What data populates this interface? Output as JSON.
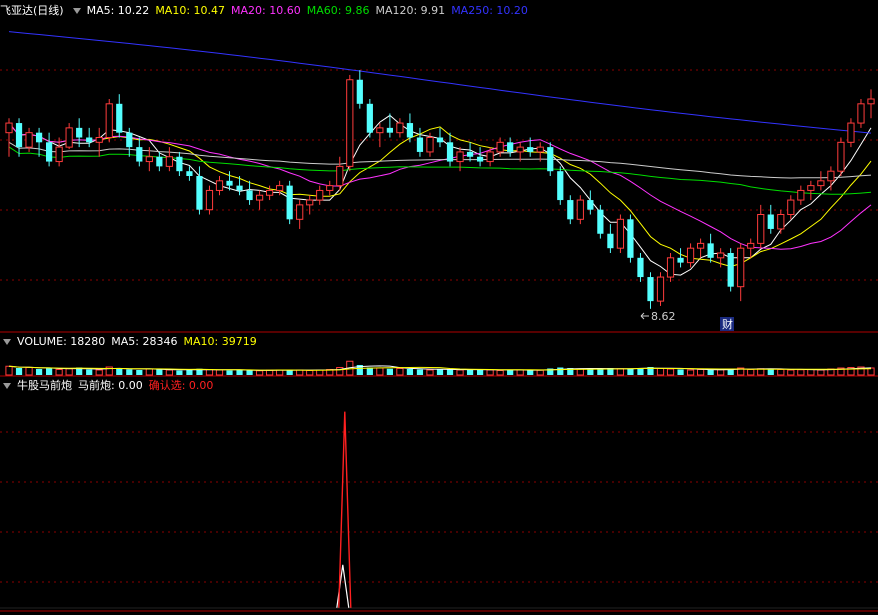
{
  "header": {
    "stock_name": "飞亚达(日线)",
    "ma5_label": "MA5: 10.22",
    "ma10_label": "MA10: 10.47",
    "ma20_label": "MA20: 10.60",
    "ma60_label": "MA60: 9.86",
    "ma120_label": "MA120: 9.91",
    "ma250_label": "MA250: 10.20"
  },
  "volume_header": {
    "volume_label": "VOLUME: 18280",
    "ma5_label": "MA5: 28346",
    "ma10_label": "MA10: 39719"
  },
  "indicator_header": {
    "name": "牛股马前炮",
    "line1_label": "马前炮: 0.00",
    "line2_label": "确认选: 0.00"
  },
  "annotations": {
    "low_price": "8.62",
    "finance_marker": "财"
  },
  "colors": {
    "up": "#ff3c3c",
    "down": "#54ffff",
    "ma5": "#ffffff",
    "ma10": "#ffff00",
    "ma20": "#ff33ff",
    "ma60": "#00dd00",
    "ma120": "#cccccc",
    "ma250": "#3333ff",
    "grid": "#8b0000",
    "indicator_line1": "#ffffff",
    "indicator_line2": "#ff2020"
  },
  "chart_data": {
    "type": "candlestick",
    "ylim": [
      8.4,
      11.6
    ],
    "candles": [
      [
        10.45,
        10.6,
        10.2,
        10.55
      ],
      [
        10.55,
        10.6,
        10.2,
        10.3
      ],
      [
        10.3,
        10.5,
        10.25,
        10.45
      ],
      [
        10.45,
        10.5,
        10.2,
        10.35
      ],
      [
        10.35,
        10.45,
        10.1,
        10.15
      ],
      [
        10.15,
        10.4,
        10.1,
        10.3
      ],
      [
        10.3,
        10.55,
        10.28,
        10.5
      ],
      [
        10.5,
        10.6,
        10.3,
        10.4
      ],
      [
        10.4,
        10.5,
        10.3,
        10.35
      ],
      [
        10.35,
        10.5,
        10.2,
        10.4
      ],
      [
        10.4,
        10.8,
        10.35,
        10.75
      ],
      [
        10.75,
        10.85,
        10.4,
        10.45
      ],
      [
        10.45,
        10.5,
        10.2,
        10.3
      ],
      [
        10.3,
        10.4,
        10.1,
        10.15
      ],
      [
        10.15,
        10.3,
        10.05,
        10.2
      ],
      [
        10.2,
        10.25,
        10.05,
        10.1
      ],
      [
        10.1,
        10.3,
        10.05,
        10.2
      ],
      [
        10.2,
        10.25,
        10.0,
        10.05
      ],
      [
        10.05,
        10.1,
        9.95,
        10.0
      ],
      [
        10.0,
        10.1,
        9.6,
        9.65
      ],
      [
        9.65,
        9.9,
        9.6,
        9.85
      ],
      [
        9.85,
        10.0,
        9.8,
        9.95
      ],
      [
        9.95,
        10.05,
        9.85,
        9.9
      ],
      [
        9.9,
        10.0,
        9.8,
        9.85
      ],
      [
        9.85,
        9.95,
        9.7,
        9.75
      ],
      [
        9.75,
        9.85,
        9.65,
        9.8
      ],
      [
        9.8,
        9.9,
        9.75,
        9.85
      ],
      [
        9.85,
        9.95,
        9.8,
        9.9
      ],
      [
        9.9,
        9.95,
        9.5,
        9.55
      ],
      [
        9.55,
        9.75,
        9.45,
        9.7
      ],
      [
        9.7,
        9.8,
        9.6,
        9.75
      ],
      [
        9.75,
        9.9,
        9.7,
        9.85
      ],
      [
        9.85,
        9.95,
        9.8,
        9.9
      ],
      [
        9.9,
        10.2,
        9.85,
        10.1
      ],
      [
        10.1,
        11.05,
        10.05,
        11.0
      ],
      [
        11.0,
        11.1,
        10.7,
        10.75
      ],
      [
        10.75,
        10.8,
        10.4,
        10.45
      ],
      [
        10.45,
        10.55,
        10.3,
        10.5
      ],
      [
        10.5,
        10.65,
        10.4,
        10.45
      ],
      [
        10.45,
        10.6,
        10.4,
        10.55
      ],
      [
        10.55,
        10.65,
        10.35,
        10.4
      ],
      [
        10.4,
        10.5,
        10.2,
        10.25
      ],
      [
        10.25,
        10.45,
        10.2,
        10.4
      ],
      [
        10.4,
        10.5,
        10.3,
        10.35
      ],
      [
        10.35,
        10.45,
        10.1,
        10.15
      ],
      [
        10.15,
        10.3,
        10.05,
        10.25
      ],
      [
        10.25,
        10.35,
        10.15,
        10.2
      ],
      [
        10.2,
        10.3,
        10.1,
        10.15
      ],
      [
        10.15,
        10.3,
        10.1,
        10.25
      ],
      [
        10.25,
        10.4,
        10.2,
        10.35
      ],
      [
        10.35,
        10.4,
        10.2,
        10.25
      ],
      [
        10.25,
        10.35,
        10.15,
        10.3
      ],
      [
        10.3,
        10.4,
        10.2,
        10.25
      ],
      [
        10.25,
        10.35,
        10.15,
        10.3
      ],
      [
        10.3,
        10.35,
        10.0,
        10.05
      ],
      [
        10.05,
        10.1,
        9.7,
        9.75
      ],
      [
        9.75,
        9.8,
        9.5,
        9.55
      ],
      [
        9.55,
        9.8,
        9.5,
        9.75
      ],
      [
        9.75,
        9.85,
        9.6,
        9.65
      ],
      [
        9.65,
        9.7,
        9.35,
        9.4
      ],
      [
        9.4,
        9.5,
        9.2,
        9.25
      ],
      [
        9.25,
        9.6,
        9.2,
        9.55
      ],
      [
        9.55,
        9.6,
        9.1,
        9.15
      ],
      [
        9.15,
        9.2,
        8.9,
        8.95
      ],
      [
        8.95,
        9.0,
        8.62,
        8.7
      ],
      [
        8.7,
        9.0,
        8.65,
        8.95
      ],
      [
        8.95,
        9.2,
        8.9,
        9.15
      ],
      [
        9.15,
        9.25,
        9.05,
        9.1
      ],
      [
        9.1,
        9.3,
        9.05,
        9.25
      ],
      [
        9.25,
        9.35,
        9.15,
        9.3
      ],
      [
        9.3,
        9.4,
        9.1,
        9.15
      ],
      [
        9.15,
        9.25,
        9.05,
        9.2
      ],
      [
        9.2,
        9.25,
        8.8,
        8.85
      ],
      [
        8.85,
        9.3,
        8.7,
        9.25
      ],
      [
        9.25,
        9.35,
        9.15,
        9.3
      ],
      [
        9.3,
        9.7,
        9.25,
        9.6
      ],
      [
        9.6,
        9.7,
        9.4,
        9.45
      ],
      [
        9.45,
        9.65,
        9.4,
        9.6
      ],
      [
        9.6,
        9.8,
        9.55,
        9.75
      ],
      [
        9.75,
        9.9,
        9.7,
        9.85
      ],
      [
        9.85,
        9.95,
        9.75,
        9.9
      ],
      [
        9.9,
        10.05,
        9.85,
        9.95
      ],
      [
        9.95,
        10.1,
        9.85,
        10.05
      ],
      [
        10.05,
        10.4,
        10.0,
        10.35
      ],
      [
        10.35,
        10.6,
        10.3,
        10.55
      ],
      [
        10.55,
        10.8,
        10.5,
        10.75
      ],
      [
        10.75,
        10.9,
        10.6,
        10.8
      ]
    ],
    "volume": [
      35,
      28,
      30,
      24,
      26,
      22,
      25,
      30,
      22,
      20,
      32,
      28,
      22,
      20,
      24,
      22,
      20,
      18,
      20,
      25,
      22,
      20,
      18,
      20,
      18,
      17,
      19,
      20,
      22,
      20,
      18,
      20,
      22,
      30,
      55,
      40,
      30,
      28,
      25,
      26,
      24,
      22,
      20,
      24,
      22,
      20,
      21,
      22,
      20,
      18,
      22,
      20,
      18,
      19,
      26,
      30,
      28,
      24,
      22,
      26,
      28,
      25,
      24,
      28,
      32,
      26,
      24,
      22,
      20,
      22,
      20,
      21,
      26,
      28,
      22,
      25,
      24,
      22,
      20,
      21,
      22,
      20,
      24,
      28,
      30,
      32,
      28
    ],
    "volume_ylim": [
      0,
      100
    ],
    "indicator": {
      "peak_index": 34,
      "line1_peak": 0.22,
      "line2_peak": 1.0,
      "ylim": [
        0,
        1.1
      ]
    }
  }
}
